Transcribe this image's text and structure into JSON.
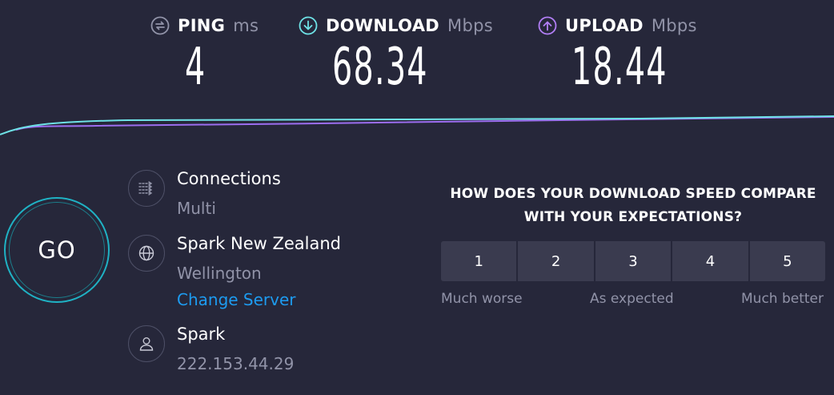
{
  "metrics": {
    "ping": {
      "label": "PING",
      "unit": "ms",
      "value": "4",
      "icon": "ping-icon",
      "color": "#9193a8"
    },
    "download": {
      "label": "DOWNLOAD",
      "unit": "Mbps",
      "value": "68.34",
      "icon": "download-arrow-icon",
      "color": "#6ee2e6"
    },
    "upload": {
      "label": "UPLOAD",
      "unit": "Mbps",
      "value": "18.44",
      "icon": "upload-arrow-icon",
      "color": "#b17ef5"
    }
  },
  "graph": {
    "download_color": "#6ee2e6",
    "upload_color": "#9c6ef0"
  },
  "go_button": {
    "label": "GO",
    "ring_color": "#1fb2c4"
  },
  "connections": {
    "title": "Connections",
    "value": "Multi",
    "icon": "connections-icon"
  },
  "server": {
    "title": "Spark New Zealand",
    "location": "Wellington",
    "change_link": "Change Server",
    "icon": "globe-icon"
  },
  "isp": {
    "title": "Spark",
    "ip": "222.153.44.29",
    "icon": "user-icon"
  },
  "survey": {
    "question": "HOW DOES YOUR DOWNLOAD SPEED COMPARE WITH YOUR EXPECTATIONS?",
    "options": [
      "1",
      "2",
      "3",
      "4",
      "5"
    ],
    "low_label": "Much worse",
    "mid_label": "As expected",
    "high_label": "Much better"
  },
  "colors": {
    "background": "#26273a",
    "link": "#1d9bf0",
    "muted": "#9193a8"
  }
}
